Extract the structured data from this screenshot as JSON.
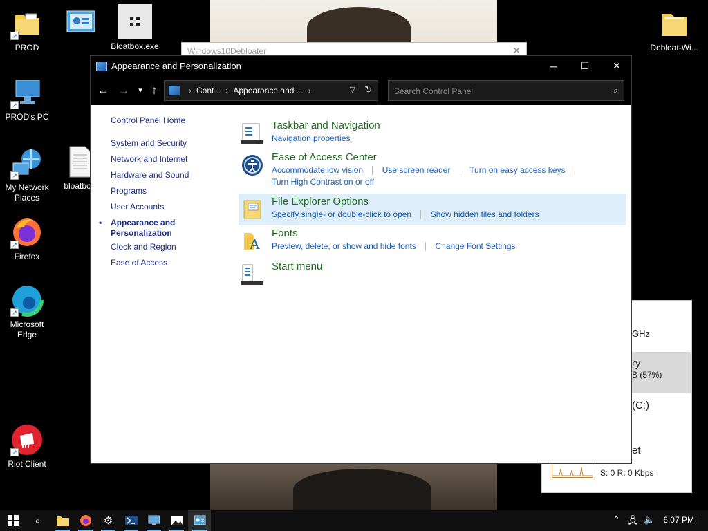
{
  "desktop": {
    "icons": [
      {
        "label": "PROD",
        "icon": "folder-icon"
      },
      {
        "label": "",
        "icon": "control-panel-icon"
      },
      {
        "label": "Bloatbox.exe",
        "icon": "app-icon"
      },
      {
        "label": "Debloat-Wi...",
        "icon": "folder-icon"
      },
      {
        "label": "PROD's PC",
        "icon": "computer-icon"
      },
      {
        "label": "My Network Places",
        "icon": "network-icon"
      },
      {
        "label": "bloatbox",
        "icon": "document-icon"
      },
      {
        "label": "Firefox",
        "icon": "firefox-icon"
      },
      {
        "label": "Microsoft Edge",
        "icon": "edge-icon"
      },
      {
        "label": "Riot Client",
        "icon": "riot-icon"
      }
    ]
  },
  "background_window": {
    "title": "Windows10Debloater"
  },
  "task_manager": {
    "cpu_speed": "GHz",
    "memory_label": "ry",
    "memory_value": "B (57%)",
    "disk_label": "(C:)",
    "ethernet_label": "et",
    "ethernet_value": "S: 0 R: 0 Kbps"
  },
  "window": {
    "title": "Appearance and Personalization",
    "address": {
      "crumb1": "Cont...",
      "crumb2": "Appearance and ..."
    },
    "search_placeholder": "Search Control Panel",
    "left_nav": {
      "home": "Control Panel Home",
      "items": [
        "System and Security",
        "Network and Internet",
        "Hardware and Sound",
        "Programs",
        "User Accounts"
      ],
      "current_line1": "Appearance and",
      "current_line2": "Personalization",
      "items_after": [
        "Clock and Region",
        "Ease of Access"
      ]
    },
    "categories": [
      {
        "title": "Taskbar and Navigation",
        "links": [
          "Navigation properties"
        ]
      },
      {
        "title": "Ease of Access Center",
        "links": [
          "Accommodate low vision",
          "Use screen reader",
          "Turn on easy access keys"
        ],
        "links2": "Turn High Contrast on or off"
      },
      {
        "title": "File Explorer Options",
        "links": [
          "Specify single- or double-click to open",
          "Show hidden files and folders"
        ]
      },
      {
        "title": "Fonts",
        "links": [
          "Preview, delete, or show and hide fonts",
          "Change Font Settings"
        ]
      },
      {
        "title": "Start menu",
        "links": []
      }
    ]
  },
  "taskbar": {
    "clock": "6:07 PM",
    "accent": "#76b9ed"
  }
}
